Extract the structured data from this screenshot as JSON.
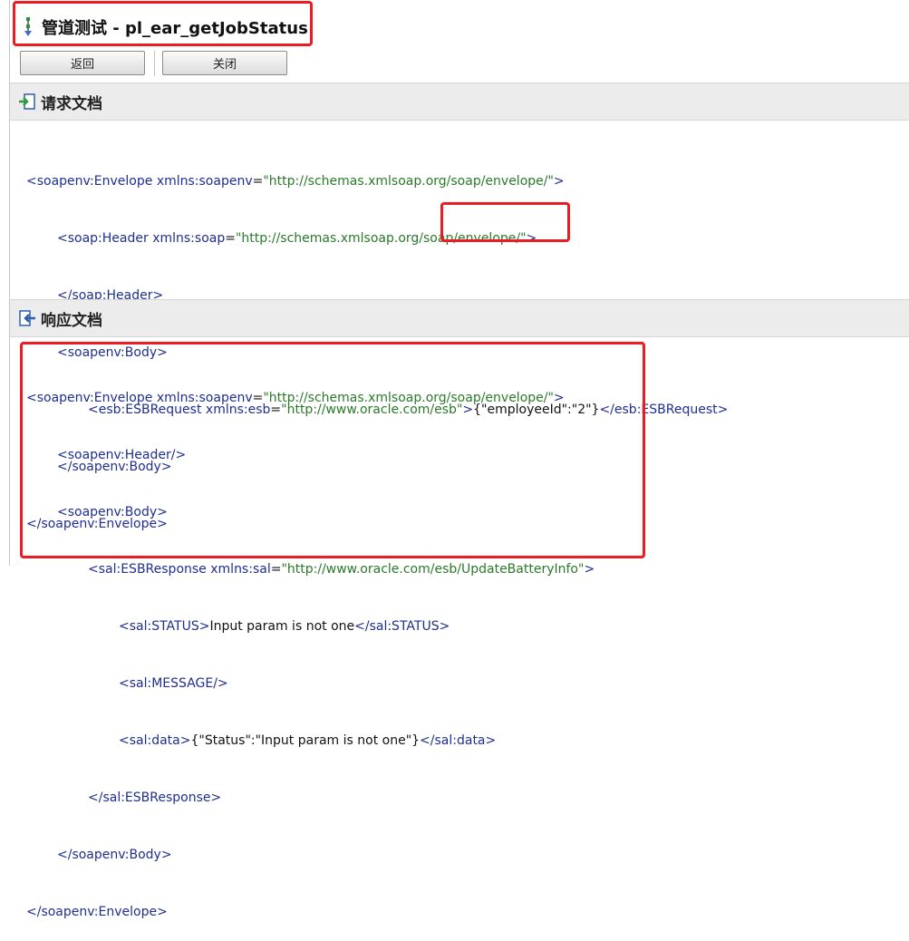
{
  "colors": {
    "highlight": "#ec1c24",
    "tag": "#1f2f8f",
    "value": "#2a7a2a",
    "header_bg": "#ececec"
  },
  "title": {
    "text": "管道测试 - pl_ear_getJobStatus",
    "icon": "pipeline-icon"
  },
  "toolbar": {
    "back_label": "返回",
    "close_label": "关闭"
  },
  "request": {
    "header": "请求文档",
    "icon": "request-import-icon",
    "lines": {
      "l1": {
        "open": "<soapenv:Envelope ",
        "attr": "xmlns:soapenv",
        "eq": "=",
        "val": "\"http://schemas.xmlsoap.org/soap/envelope/\"",
        "close": ">"
      },
      "l2": {
        "open": "<soap:Header ",
        "attr": "xmlns:soap",
        "eq": "=",
        "val": "\"http://schemas.xmlsoap.org/soap/envelope/\"",
        "close": ">"
      },
      "l3": {
        "tag": "</soap:Header>"
      },
      "l4": {
        "tag": "<soapenv:Body>"
      },
      "l5": {
        "open": "<esb:ESBRequest ",
        "attr": "xmlns:esb",
        "eq": "=",
        "val": "\"http://www.oracle.com/esb\"",
        "close": ">",
        "text": "{\"employeeId\":\"2\"}",
        "end": "</esb:ESBRequest>"
      },
      "l6": {
        "tag": "</soapenv:Body>"
      },
      "l7": {
        "tag": "</soapenv:Envelope>"
      }
    }
  },
  "response": {
    "header": "响应文档",
    "icon": "response-export-icon",
    "lines": {
      "l1": {
        "open": "<soapenv:Envelope ",
        "attr": "xmlns:soapenv",
        "eq": "=",
        "val": "\"http://schemas.xmlsoap.org/soap/envelope/\"",
        "close": ">"
      },
      "l2": {
        "tag": "<soapenv:Header/>"
      },
      "l3": {
        "tag": "<soapenv:Body>"
      },
      "l4": {
        "open": "<sal:ESBResponse ",
        "attr": "xmlns:sal",
        "eq": "=",
        "val": "\"http://www.oracle.com/esb/UpdateBatteryInfo\"",
        "close": ">"
      },
      "l5": {
        "open": "<sal:STATUS>",
        "text": "Input param is not one",
        "end": "</sal:STATUS>"
      },
      "l6": {
        "tag": "<sal:MESSAGE/>"
      },
      "l7": {
        "open": "<sal:data>",
        "text": "{\"Status\":\"Input param is not one\"}",
        "end": "</sal:data>"
      },
      "l8": {
        "tag": "</sal:ESBResponse>"
      },
      "l9": {
        "tag": "</soapenv:Body>"
      },
      "l10": {
        "tag": "</soapenv:Envelope>"
      }
    }
  }
}
